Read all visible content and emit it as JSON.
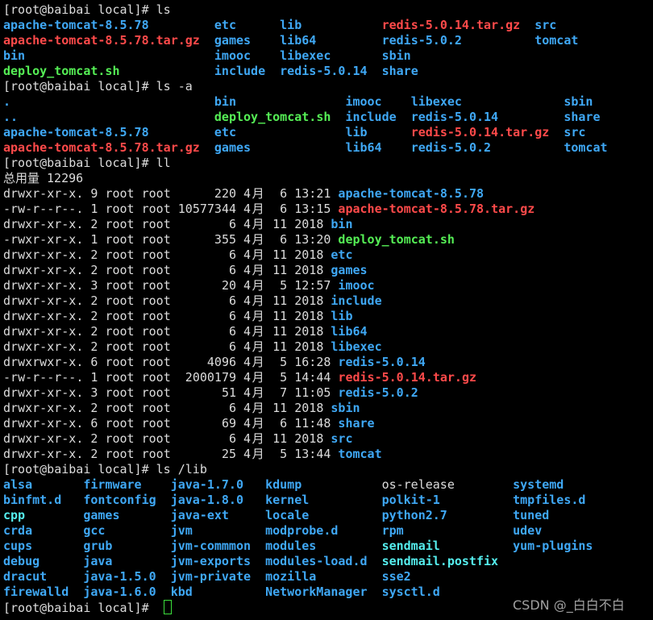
{
  "prompt": "[root@baibai local]# ",
  "colors": {
    "dir": "#3fa8f5",
    "archive": "#ff4a4a",
    "exec": "#55ee55",
    "link": "#55eeee",
    "file": "#dcdcdc",
    "cursor": "#3ce03c"
  },
  "sections": [
    {
      "command": "ls",
      "rows": [
        [
          [
            "apache-tomcat-8.5.78",
            "dir"
          ],
          [
            "etc",
            "dir"
          ],
          [
            "lib",
            "dir"
          ],
          [
            "redis-5.0.14.tar.gz",
            "archive"
          ],
          [
            "src",
            "dir"
          ]
        ],
        [
          [
            "apache-tomcat-8.5.78.tar.gz",
            "archive"
          ],
          [
            "games",
            "dir"
          ],
          [
            "lib64",
            "dir"
          ],
          [
            "redis-5.0.2",
            "dir"
          ],
          [
            "tomcat",
            "dir"
          ]
        ],
        [
          [
            "bin",
            "dir"
          ],
          [
            "imooc",
            "dir"
          ],
          [
            "libexec",
            "dir"
          ],
          [
            "sbin",
            "dir"
          ]
        ],
        [
          [
            "deploy_tomcat.sh",
            "exec"
          ],
          [
            "include",
            "dir"
          ],
          [
            "redis-5.0.14",
            "dir"
          ],
          [
            "share",
            "dir"
          ]
        ]
      ]
    },
    {
      "command": "ls -a",
      "rows": [
        [
          [
            ".",
            "dir"
          ],
          [
            "bin",
            "dir"
          ],
          [
            "imooc",
            "dir"
          ],
          [
            "libexec",
            "dir"
          ],
          [
            "sbin",
            "dir"
          ]
        ],
        [
          [
            "..",
            "dir"
          ],
          [
            "deploy_tomcat.sh",
            "exec"
          ],
          [
            "include",
            "dir"
          ],
          [
            "redis-5.0.14",
            "dir"
          ],
          [
            "share",
            "dir"
          ]
        ],
        [
          [
            "apache-tomcat-8.5.78",
            "dir"
          ],
          [
            "etc",
            "dir"
          ],
          [
            "lib",
            "dir"
          ],
          [
            "redis-5.0.14.tar.gz",
            "archive"
          ],
          [
            "src",
            "dir"
          ]
        ],
        [
          [
            "apache-tomcat-8.5.78.tar.gz",
            "archive"
          ],
          [
            "games",
            "dir"
          ],
          [
            "lib64",
            "dir"
          ],
          [
            "redis-5.0.2",
            "dir"
          ],
          [
            "tomcat",
            "dir"
          ]
        ]
      ]
    },
    {
      "command": "ll",
      "total": "总用量 12296",
      "entries": [
        {
          "meta": "drwxr-xr-x. 9 root root      220 4月  6 13:21 ",
          "name": "apache-tomcat-8.5.78",
          "type": "dir"
        },
        {
          "meta": "-rw-r--r--. 1 root root 10577344 4月  6 13:15 ",
          "name": "apache-tomcat-8.5.78.tar.gz",
          "type": "archive"
        },
        {
          "meta": "drwxr-xr-x. 2 root root        6 4月 11 2018 ",
          "name": "bin",
          "type": "dir"
        },
        {
          "meta": "-rwxr-xr-x. 1 root root      355 4月  6 13:20 ",
          "name": "deploy_tomcat.sh",
          "type": "exec"
        },
        {
          "meta": "drwxr-xr-x. 2 root root        6 4月 11 2018 ",
          "name": "etc",
          "type": "dir"
        },
        {
          "meta": "drwxr-xr-x. 2 root root        6 4月 11 2018 ",
          "name": "games",
          "type": "dir"
        },
        {
          "meta": "drwxr-xr-x. 3 root root       20 4月  5 12:57 ",
          "name": "imooc",
          "type": "dir"
        },
        {
          "meta": "drwxr-xr-x. 2 root root        6 4月 11 2018 ",
          "name": "include",
          "type": "dir"
        },
        {
          "meta": "drwxr-xr-x. 2 root root        6 4月 11 2018 ",
          "name": "lib",
          "type": "dir"
        },
        {
          "meta": "drwxr-xr-x. 2 root root        6 4月 11 2018 ",
          "name": "lib64",
          "type": "dir"
        },
        {
          "meta": "drwxr-xr-x. 2 root root        6 4月 11 2018 ",
          "name": "libexec",
          "type": "dir"
        },
        {
          "meta": "drwxrwxr-x. 6 root root     4096 4月  5 16:28 ",
          "name": "redis-5.0.14",
          "type": "dir"
        },
        {
          "meta": "-rw-r--r--. 1 root root  2000179 4月  5 14:44 ",
          "name": "redis-5.0.14.tar.gz",
          "type": "archive"
        },
        {
          "meta": "drwxr-xr-x. 3 root root       51 4月  7 11:05 ",
          "name": "redis-5.0.2",
          "type": "dir"
        },
        {
          "meta": "drwxr-xr-x. 2 root root        6 4月 11 2018 ",
          "name": "sbin",
          "type": "dir"
        },
        {
          "meta": "drwxr-xr-x. 6 root root       69 4月  6 11:48 ",
          "name": "share",
          "type": "dir"
        },
        {
          "meta": "drwxr-xr-x. 2 root root        6 4月 11 2018 ",
          "name": "src",
          "type": "dir"
        },
        {
          "meta": "drwxr-xr-x. 2 root root       25 4月  5 13:44 ",
          "name": "tomcat",
          "type": "dir"
        }
      ]
    },
    {
      "command": "ls /lib",
      "rows": [
        [
          [
            "alsa",
            "dir"
          ],
          [
            "firmware",
            "dir"
          ],
          [
            "java-1.7.0",
            "dir"
          ],
          [
            "kdump",
            "dir"
          ],
          [
            "os-release",
            "file"
          ],
          [
            "systemd",
            "dir"
          ]
        ],
        [
          [
            "binfmt.d",
            "dir"
          ],
          [
            "fontconfig",
            "dir"
          ],
          [
            "java-1.8.0",
            "dir"
          ],
          [
            "kernel",
            "dir"
          ],
          [
            "polkit-1",
            "dir"
          ],
          [
            "tmpfiles.d",
            "dir"
          ]
        ],
        [
          [
            "cpp",
            "link"
          ],
          [
            "games",
            "dir"
          ],
          [
            "java-ext",
            "dir"
          ],
          [
            "locale",
            "dir"
          ],
          [
            "python2.7",
            "dir"
          ],
          [
            "tuned",
            "dir"
          ]
        ],
        [
          [
            "crda",
            "dir"
          ],
          [
            "gcc",
            "dir"
          ],
          [
            "jvm",
            "dir"
          ],
          [
            "modprobe.d",
            "dir"
          ],
          [
            "rpm",
            "dir"
          ],
          [
            "udev",
            "dir"
          ]
        ],
        [
          [
            "cups",
            "dir"
          ],
          [
            "grub",
            "dir"
          ],
          [
            "jvm-commmon",
            "dir"
          ],
          [
            "modules",
            "dir"
          ],
          [
            "sendmail",
            "link"
          ],
          [
            "yum-plugins",
            "dir"
          ]
        ],
        [
          [
            "debug",
            "dir"
          ],
          [
            "java",
            "dir"
          ],
          [
            "jvm-exports",
            "dir"
          ],
          [
            "modules-load.d",
            "dir"
          ],
          [
            "sendmail.postfix",
            "link"
          ]
        ],
        [
          [
            "dracut",
            "dir"
          ],
          [
            "java-1.5.0",
            "dir"
          ],
          [
            "jvm-private",
            "dir"
          ],
          [
            "mozilla",
            "dir"
          ],
          [
            "sse2",
            "dir"
          ]
        ],
        [
          [
            "firewalld",
            "dir"
          ],
          [
            "java-1.6.0",
            "dir"
          ],
          [
            "kbd",
            "dir"
          ],
          [
            "NetworkManager",
            "dir"
          ],
          [
            "sysctl.d",
            "dir"
          ]
        ]
      ]
    }
  ],
  "watermark": "CSDN @_白白不白"
}
